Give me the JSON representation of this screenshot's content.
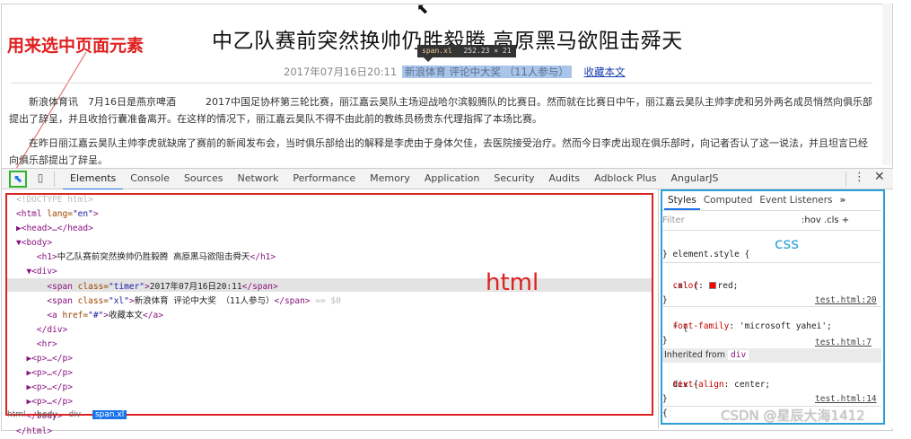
{
  "page": {
    "title": "中乙队赛前突然换帅仍胜毅腾 高原黑马欲阻击舜天",
    "timer": "2017年07月16日20:11",
    "highlighted_span": "新浪体育 评论中大奖 （11人参与）",
    "favorite_link": "收藏本文",
    "tooltip_selector": "span.xl",
    "tooltip_size": "252.23 × 21",
    "paragraph_1": "新浪体育讯　7月16日是燕京啤酒　　　2017中国足协杯第三轮比赛，丽江嘉云昊队主场迎战哈尔滨毅腾队的比赛日。然而就在比赛日中午，丽江嘉云昊队主帅李虎和另外两名成员悄然向俱乐部提出了辞呈，并且收拾行囊准备离开。在这样的情况下，丽江嘉云昊队不得不由此前的教练员杨贵东代理指挥了本场比赛。",
    "paragraph_2": "在昨日丽江嘉云昊队主帅李虎就缺席了赛前的新闻发布会，当时俱乐部给出的解释是李虎由于身体欠佳，去医院接受治疗。然而今日李虎出现在俱乐部时，向记者否认了这一说法，并且坦言已经向俱乐部提出了辞呈。"
  },
  "annotations": {
    "select_element_note": "用来选中页面元素",
    "html_label": "html",
    "css_label": "css"
  },
  "devtools": {
    "tabs": [
      "Elements",
      "Console",
      "Sources",
      "Network",
      "Performance",
      "Memory",
      "Application",
      "Security",
      "Audits",
      "Adblock Plus",
      "AngularJS"
    ],
    "kebab": "⋮",
    "close": "✕",
    "code_lines": {
      "doctype": "<!DOCTYPE html>",
      "html_open_tag": "<html",
      "html_lang_attr": " lang=",
      "html_lang_val": "\"en\"",
      "html_close_bracket": ">",
      "head": "▶<head>…</head>",
      "body_open": "▼<body>",
      "h1_open": "<h1>",
      "h1_text": "中乙队赛前突然换帅仍胜毅腾 高原黑马欲阻击舜天",
      "h1_close": "</h1>",
      "div_open": "▼<div>",
      "span1_open": "<span",
      "span1_class_attr": " class=",
      "span1_class_val": "\"timer\"",
      "span1_text": "2017年07月16日20:11",
      "span_close": "</span>",
      "span2_open": "<span",
      "span2_class_attr": " class=",
      "span2_class_val": "\"xl\"",
      "span2_text": "新浪体育 评论中大奖 （11人参与）",
      "span2_close": "</span>",
      "span2_eq": " == $0",
      "a_open": "<a",
      "a_href_attr": " href=",
      "a_href_val": "\"#\"",
      "a_text": "收藏本文",
      "a_close": "</a>",
      "div_close": "</div>",
      "hr": "<hr>",
      "p": "▶<p>…</p>",
      "body_close": "</body>",
      "html_close": "</html>"
    },
    "breadcrumbs": [
      "html",
      "body",
      "div",
      "span.xl"
    ],
    "styles_tabs": [
      "Styles",
      "Computed",
      "Event Listeners"
    ],
    "styles_more": "»",
    "filter_placeholder": "Filter",
    "hov_cls": ":hov  .cls  +",
    "rules": {
      "element_style": "element.style {",
      "xl_selector": ".xl {",
      "xl_link": "test.html:20",
      "xl_prop": "color",
      "xl_value": "red;",
      "font_selector": "* {",
      "font_link": "test.html:7",
      "font_prop": "font-family",
      "font_value": "'microsoft yahei';",
      "inherited_prefix": "Inherited from",
      "inherited_tag": "div",
      "div_selector": "div {",
      "div_link": "test.html:14",
      "div_prop": "text-align",
      "div_value": "center;",
      "close_brace": "}",
      "last_open": "{"
    }
  },
  "watermark": "CSDN @星辰大海1412",
  "colors": {
    "annotation_red": "#dd2222",
    "annotation_blue": "#2a9fd8",
    "inspect_green": "#2db52d",
    "devtools_accent": "#1a73e8"
  },
  "icons": [
    "inspect-element-icon",
    "device-toolbar-icon",
    "kebab-menu-icon",
    "close-icon",
    "mouse-cursor-icon",
    "color-swatch-icon"
  ]
}
